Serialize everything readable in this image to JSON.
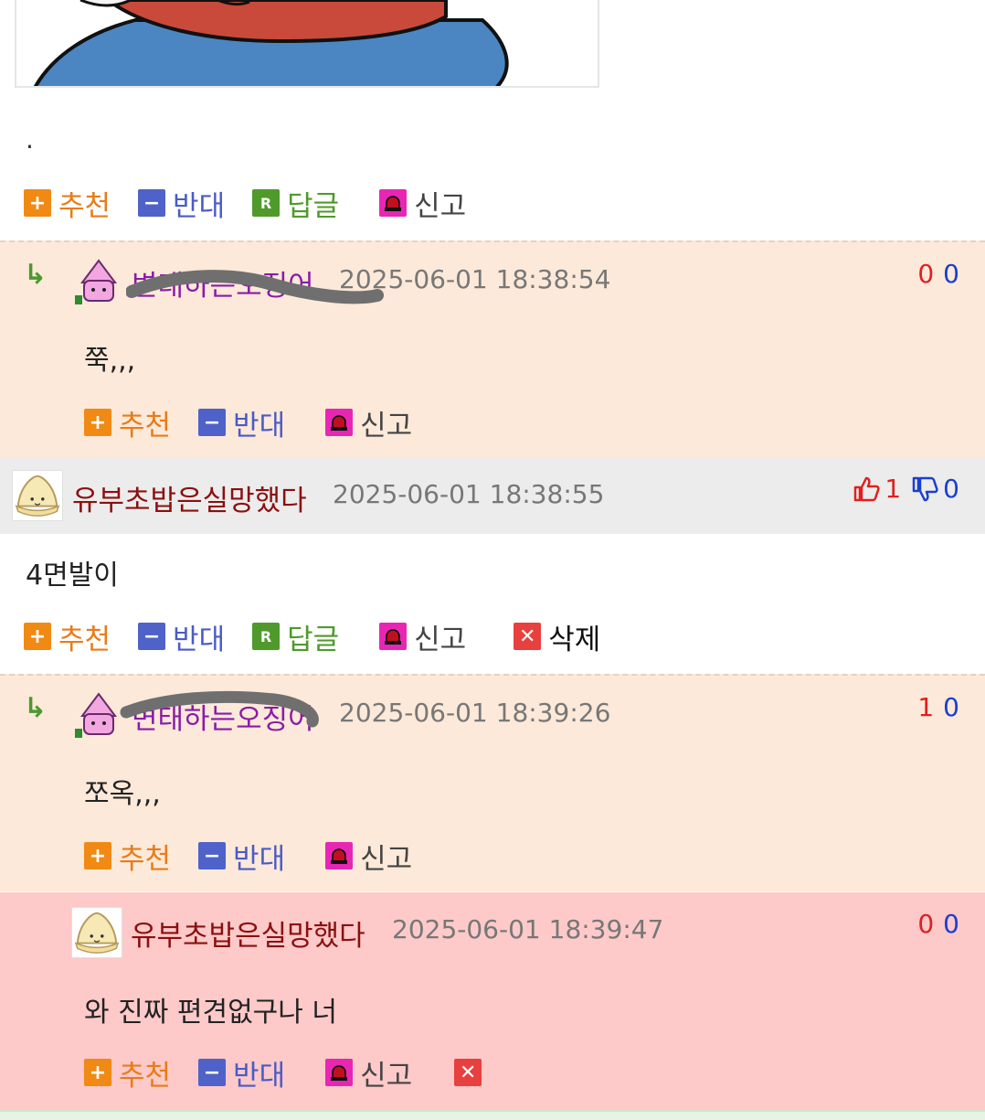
{
  "post": {
    "body_text": ".",
    "actions": {
      "recommend": "추천",
      "oppose": "반대",
      "reply": "답글",
      "report": "신고"
    }
  },
  "comments": [
    {
      "nickname": "변태하는오징어",
      "time": "2025-06-01 18:38:54",
      "up": "0",
      "down": "0",
      "text": "쭉,,,",
      "actions": {
        "recommend": "추천",
        "oppose": "반대",
        "report": "신고"
      }
    },
    {
      "nickname": "유부초밥은실망했다",
      "time": "2025-06-01 18:38:55",
      "up": "1",
      "down": "0",
      "text": "4면발이",
      "actions": {
        "recommend": "추천",
        "oppose": "반대",
        "reply": "답글",
        "report": "신고",
        "delete": "삭제"
      }
    },
    {
      "nickname": "변태하는오징어",
      "time": "2025-06-01 18:39:26",
      "up": "1",
      "down": "0",
      "text": "쪼옥,,,",
      "actions": {
        "recommend": "추천",
        "oppose": "반대",
        "report": "신고"
      }
    },
    {
      "nickname": "유부초밥은실망했다",
      "time": "2025-06-01 18:39:47",
      "up": "0",
      "down": "0",
      "text": "와 진짜 편견없구나 너",
      "actions": {
        "recommend": "추천",
        "oppose": "반대",
        "report": "신고"
      }
    }
  ],
  "colors": {
    "reply_bg": "#fde9d9",
    "pink_bg": "#fdc9c9",
    "gray_bar": "#ececec",
    "recommend": "#f08a15",
    "oppose": "#4f62c9",
    "reply": "#4f9a2b",
    "report": "#e826b4",
    "delete": "#e8403e"
  },
  "icons": {
    "recommend": "plus-icon",
    "oppose": "minus-icon",
    "reply": "reply-r-icon",
    "report": "siren-icon",
    "delete": "close-x-icon",
    "thumbs_up": "thumbs-up-icon",
    "thumbs_down": "thumbs-down-icon"
  }
}
